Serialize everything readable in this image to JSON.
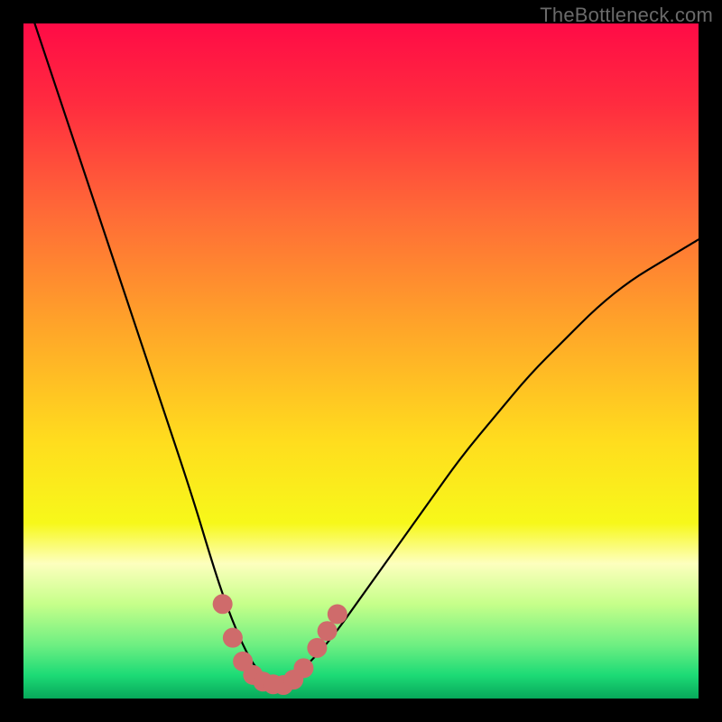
{
  "watermark": "TheBottleneck.com",
  "chart_data": {
    "type": "line",
    "title": "",
    "xlabel": "",
    "ylabel": "",
    "xlim": [
      0,
      100
    ],
    "ylim": [
      0,
      100
    ],
    "grid": false,
    "series": [
      {
        "name": "bottleneck-curve",
        "x": [
          0,
          5,
          10,
          15,
          20,
          25,
          28,
          30,
          32,
          34,
          36,
          38,
          40,
          45,
          50,
          55,
          60,
          65,
          70,
          75,
          80,
          85,
          90,
          95,
          100
        ],
        "y": [
          105,
          90,
          75,
          60,
          45,
          30,
          20,
          14,
          9,
          5,
          3,
          2,
          3,
          8,
          15,
          22,
          29,
          36,
          42,
          48,
          53,
          58,
          62,
          65,
          68
        ]
      }
    ],
    "markers": {
      "name": "highlight-dots",
      "color": "#cf6b6b",
      "points": [
        {
          "x": 29.5,
          "y": 14
        },
        {
          "x": 31.0,
          "y": 9
        },
        {
          "x": 32.5,
          "y": 5.5
        },
        {
          "x": 34.0,
          "y": 3.5
        },
        {
          "x": 35.5,
          "y": 2.5
        },
        {
          "x": 37.0,
          "y": 2.1
        },
        {
          "x": 38.5,
          "y": 2.0
        },
        {
          "x": 40.0,
          "y": 2.8
        },
        {
          "x": 41.5,
          "y": 4.5
        },
        {
          "x": 43.5,
          "y": 7.5
        },
        {
          "x": 45.0,
          "y": 10
        },
        {
          "x": 46.5,
          "y": 12.5
        }
      ]
    },
    "gradient_stops": [
      {
        "offset": 0.0,
        "color": "#ff0b46"
      },
      {
        "offset": 0.12,
        "color": "#ff2c3f"
      },
      {
        "offset": 0.28,
        "color": "#ff6a37"
      },
      {
        "offset": 0.45,
        "color": "#ffa529"
      },
      {
        "offset": 0.62,
        "color": "#ffdd1e"
      },
      {
        "offset": 0.74,
        "color": "#f7f81a"
      },
      {
        "offset": 0.8,
        "color": "#fdffbe"
      },
      {
        "offset": 0.86,
        "color": "#c6ff8a"
      },
      {
        "offset": 0.92,
        "color": "#6fef82"
      },
      {
        "offset": 0.965,
        "color": "#1ddb76"
      },
      {
        "offset": 1.0,
        "color": "#07a85a"
      }
    ]
  }
}
